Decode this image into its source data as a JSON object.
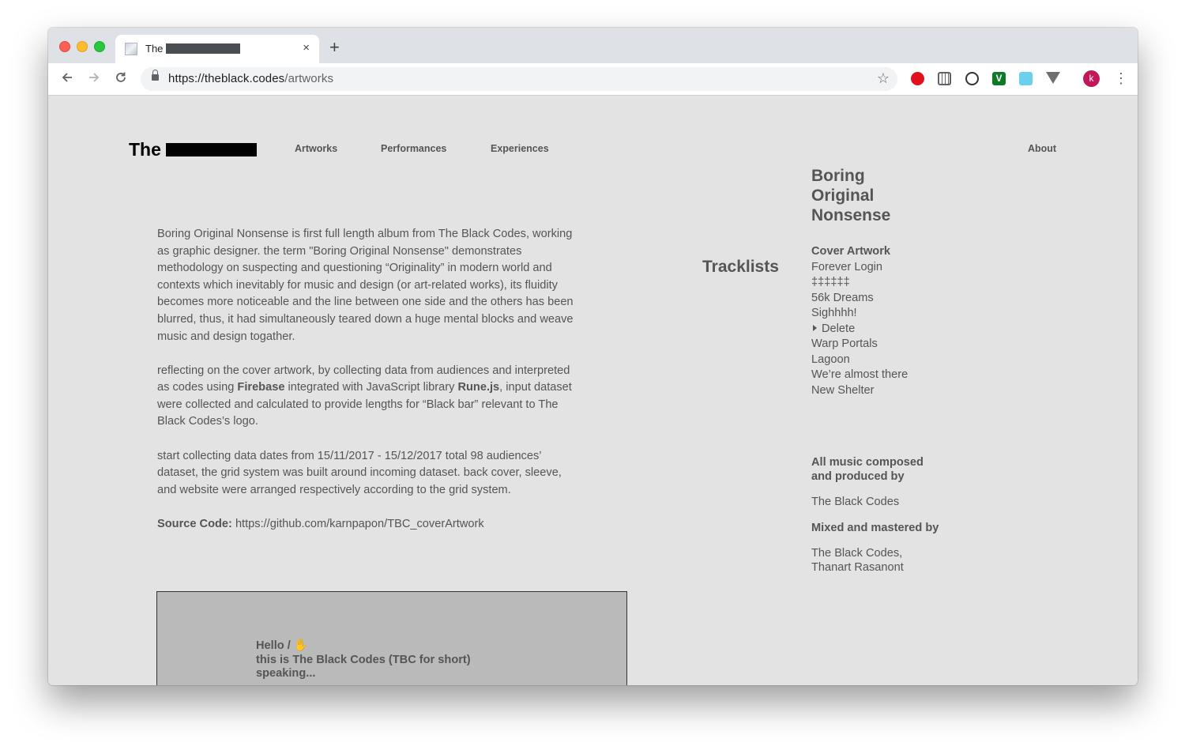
{
  "browser": {
    "tab_title": "The",
    "tab_close": "×",
    "new_tab": "+",
    "url_host": "https://theblack.codes",
    "url_path": "/artworks",
    "avatar_initial": "k",
    "extension_icons": [
      "adblock-icon",
      "grid-icon",
      "circle-icon",
      "vimium-icon",
      "square-icon",
      "vivaldi-icon"
    ]
  },
  "site": {
    "logo_text": "The",
    "nav": {
      "artworks": "Artworks",
      "performances": "Performances",
      "experiences": "Experiences",
      "about": "About"
    }
  },
  "intro": {
    "p1": "Boring Original Nonsense is first full length album from The Black Codes, working as graphic designer. the term \"Boring Original Nonsense\" demonstrates methodology on suspecting and questioning “Originality” in modern world and contexts which inevitably for music and design (or art-related works), its fluidity becomes more noticeable and the line between one side and the others has been blurred, thus, it had simultaneously teared down a huge mental blocks and weave music and design togather.",
    "p2_a": "reflecting on the cover artwork, by collecting data from audiences and interpreted as codes using ",
    "p2_firebase": "Firebase",
    "p2_b": " integrated with JavaScript library ",
    "p2_rune": "Rune.js",
    "p2_c": ", input dataset were collected and calculated to provide lengths for “Black bar” relevant to The Black Codes’s logo.",
    "p3": "start collecting data dates from 15/11/2017 - 15/12/2017 total 98 audiences’ dataset, the grid system was built around incoming dataset. back cover, sleeve, and website were arranged respectively according to the grid system.",
    "source_label": "Source Code:",
    "source_url": "https://github.com/karnpapon/TBC_coverArtwork"
  },
  "album": {
    "title_line1": "Boring",
    "title_line2": "Original",
    "title_line3": "Nonsense",
    "tracklists_heading": "Tracklists",
    "tracks": [
      "Cover Artwork",
      "Forever Login",
      "‡‡‡‡‡‡",
      "56k Dreams",
      "Sighhhh!",
      "Delete",
      "Warp Portals",
      "Lagoon",
      "We’re almost there",
      "New Shelter"
    ]
  },
  "credits": {
    "composed_heading_1": "All music composed",
    "composed_heading_2": "and produced by",
    "composed_by": "The Black Codes",
    "mixed_heading": "Mixed and mastered by",
    "mixed_by_1": "The Black Codes,",
    "mixed_by_2": "Thanart Rasanont"
  },
  "card": {
    "line1": "Hello / ✋",
    "line2": "this is The Black Codes (TBC for short)",
    "line3": "speaking..."
  }
}
